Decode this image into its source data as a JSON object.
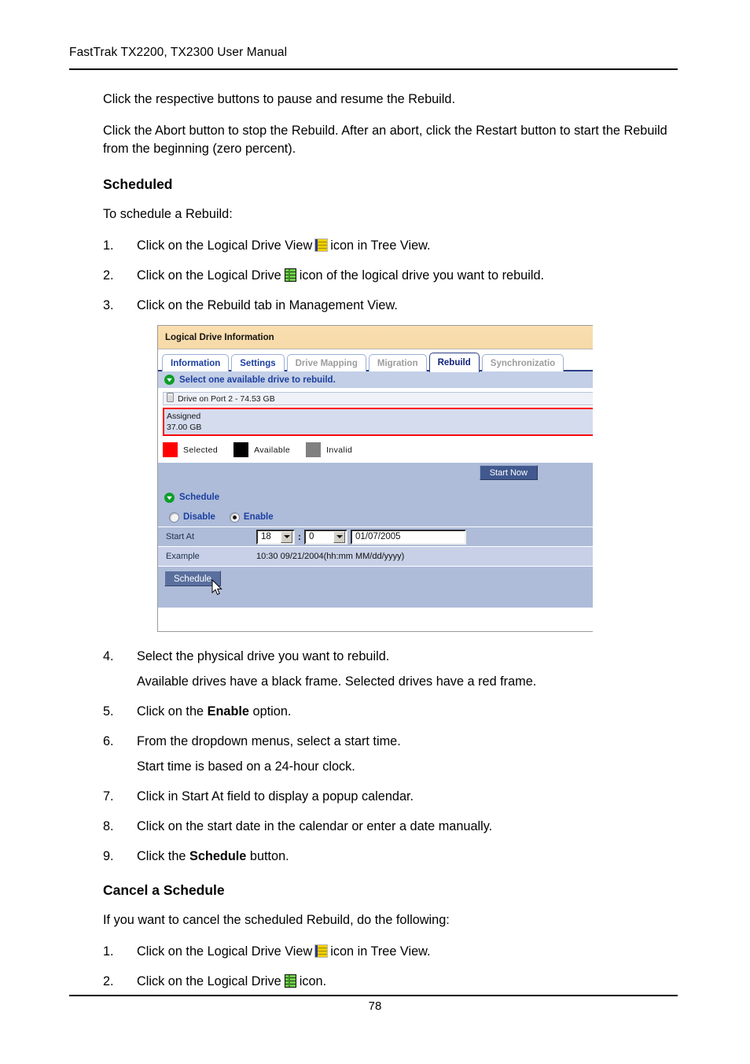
{
  "header": {
    "title": "FastTrak TX2200, TX2300 User Manual"
  },
  "body": {
    "intro_paragraphs": [
      "Click the respective buttons to pause and resume the Rebuild.",
      "Click the Abort button to stop the Rebuild. After an abort, click the Restart button to start the Rebuild from the beginning (zero percent)."
    ],
    "scheduled_heading": "Scheduled",
    "scheduled_lead": "To schedule a Rebuild:",
    "steps_before": [
      {
        "num": "1.",
        "text_before": "Click on the Logical Drive View",
        "icon": "logical-drive-view-icon",
        "text_after": "icon in Tree View."
      },
      {
        "num": "2.",
        "text_before": "Click on the Logical Drive",
        "icon": "logical-drive-icon",
        "text_after": "icon of the logical drive you want to rebuild."
      },
      {
        "num": "3.",
        "text_before": "Click on the Rebuild tab in Management View.",
        "icon": "",
        "text_after": ""
      }
    ],
    "steps_after": [
      {
        "num": "4.",
        "text": "Select the physical drive you want to rebuild.",
        "sub": "Available drives have a black frame. Selected drives have a red frame."
      },
      {
        "num": "5.",
        "text_a": "Click on the ",
        "bold": "Enable",
        "text_b": " option.",
        "sub": ""
      },
      {
        "num": "6.",
        "text": "From the dropdown menus, select a start time.",
        "sub": "Start time is based on a 24-hour clock."
      },
      {
        "num": "7.",
        "text": "Click in Start At field to display a popup calendar.",
        "sub": ""
      },
      {
        "num": "8.",
        "text": "Click on the start date in the calendar or enter a date manually.",
        "sub": ""
      },
      {
        "num": "9.",
        "text_a": "Click the ",
        "bold": "Schedule",
        "text_b": " button.",
        "sub": ""
      }
    ],
    "cancel_heading": "Cancel a Schedule",
    "cancel_lead": "If you want to cancel the scheduled Rebuild, do the following:",
    "cancel_steps": [
      {
        "num": "1.",
        "text_before": "Click on the Logical Drive View",
        "icon": "logical-drive-view-icon",
        "text_after": "icon in Tree View."
      },
      {
        "num": "2.",
        "text_before": "Click on the Logical Drive",
        "icon": "logical-drive-icon",
        "text_after": "icon."
      }
    ]
  },
  "screenshot": {
    "window_title": "Logical Drive Information",
    "tabs": [
      {
        "label": "Information",
        "state": "enabled"
      },
      {
        "label": "Settings",
        "state": "enabled"
      },
      {
        "label": "Drive Mapping",
        "state": "disabled"
      },
      {
        "label": "Migration",
        "state": "disabled"
      },
      {
        "label": "Rebuild",
        "state": "active"
      },
      {
        "label": "Synchronizatio",
        "state": "disabled"
      }
    ],
    "select_drive_header": "Select one available drive to rebuild.",
    "drive": {
      "port_label": "Drive on Port 2 - 74.53 GB",
      "status": "Assigned",
      "capacity": "37.00 GB"
    },
    "legend": [
      {
        "label": "Selected",
        "color": "#ff0000"
      },
      {
        "label": "Available",
        "color": "#000000"
      },
      {
        "label": "Invalid",
        "color": "#808080"
      }
    ],
    "start_now_label": "Start Now",
    "schedule_header": "Schedule",
    "radios": [
      {
        "label": "Disable",
        "selected": false
      },
      {
        "label": "Enable",
        "selected": true
      }
    ],
    "start_at_label": "Start At",
    "start_at_hour": "18",
    "start_at_minute": "0",
    "start_at_date": "01/07/2005",
    "example_label": "Example",
    "example_value": "10:30 09/21/2004(hh:mm MM/dd/yyyy)",
    "schedule_button_label": "Schedule"
  },
  "footer": {
    "page_number": "78"
  }
}
